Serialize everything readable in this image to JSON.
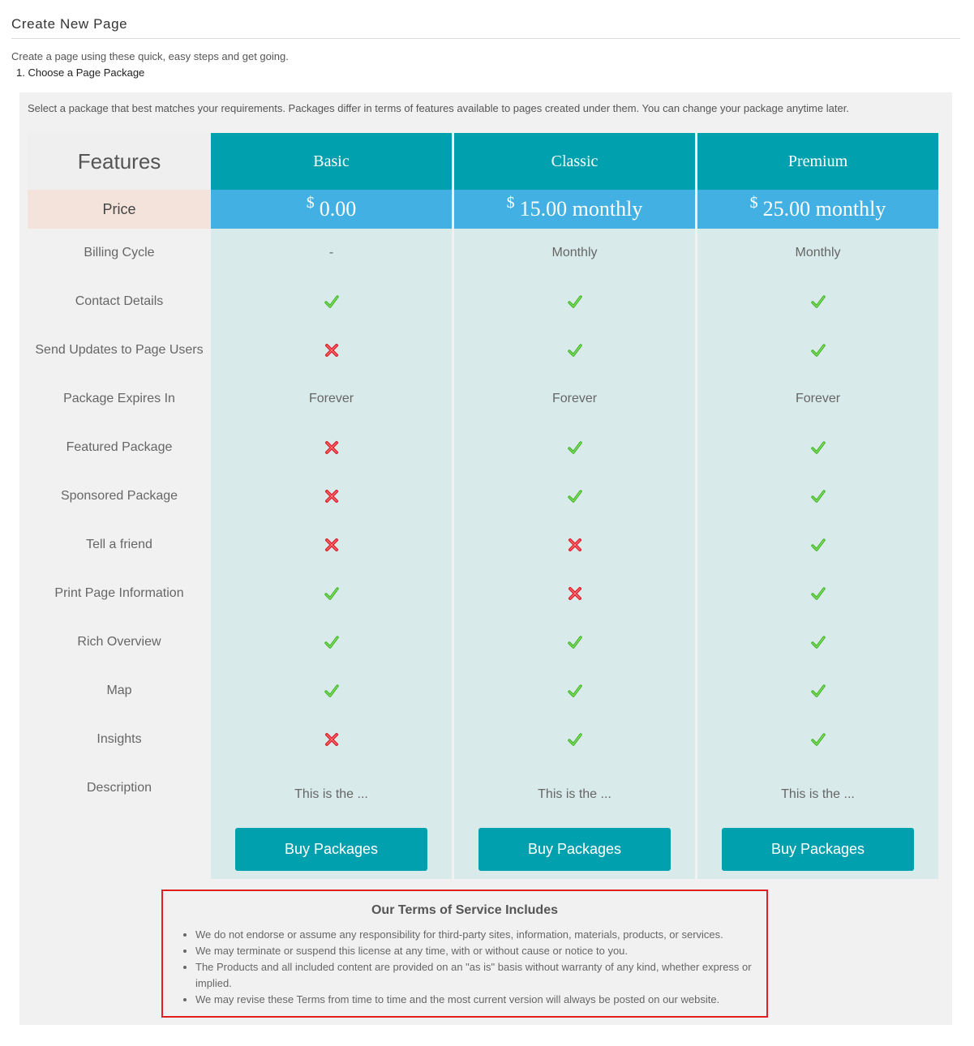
{
  "page": {
    "title": "Create New Page",
    "intro": "Create a page using these quick, easy steps and get going.",
    "step": "1. Choose a Page Package"
  },
  "panel": {
    "description": "Select a package that best matches your requirements. Packages differ in terms of features available to pages created under them. You can change your package anytime later."
  },
  "features": {
    "header": "Features",
    "price_label": "Price",
    "rows": [
      "Billing Cycle",
      "Contact Details",
      "Send Updates to Page Users",
      "Package Expires In",
      "Featured Package",
      "Sponsored Package",
      "Tell a friend",
      "Print Page Information",
      "Rich Overview",
      "Map",
      "Insights",
      "Description"
    ]
  },
  "plans": [
    {
      "name": "Basic",
      "currency": "$",
      "price": "0.00",
      "billing_cycle": "-",
      "contact_details": "check-icon",
      "send_updates": "cross-icon",
      "expires_in": "Forever",
      "featured": "cross-icon",
      "sponsored": "cross-icon",
      "tell_friend": "cross-icon",
      "print_info": "check-icon",
      "rich_overview": "check-icon",
      "map": "check-icon",
      "insights": "cross-icon",
      "description": "This is the ...",
      "button_label": "Buy Packages"
    },
    {
      "name": "Classic",
      "currency": "$",
      "price": "15.00 monthly",
      "billing_cycle": "Monthly",
      "contact_details": "check-icon",
      "send_updates": "check-icon",
      "expires_in": "Forever",
      "featured": "check-icon",
      "sponsored": "check-icon",
      "tell_friend": "cross-icon",
      "print_info": "cross-icon",
      "rich_overview": "check-icon",
      "map": "check-icon",
      "insights": "check-icon",
      "description": "This is the ...",
      "button_label": "Buy Packages"
    },
    {
      "name": "Premium",
      "currency": "$",
      "price": "25.00 monthly",
      "billing_cycle": "Monthly",
      "contact_details": "check-icon",
      "send_updates": "check-icon",
      "expires_in": "Forever",
      "featured": "check-icon",
      "sponsored": "check-icon",
      "tell_friend": "check-icon",
      "print_info": "check-icon",
      "rich_overview": "check-icon",
      "map": "check-icon",
      "insights": "check-icon",
      "description": "This is the ...",
      "button_label": "Buy Packages"
    }
  ],
  "terms": {
    "title": "Our Terms of Service Includes",
    "items": [
      "We do not endorse or assume any responsibility for third-party sites, information, materials, products, or services.",
      "We may terminate or suspend this license at any time, with or without cause or notice to you.",
      "The Products and all included content are provided on an \"as is\" basis without warranty of any kind, whether express or implied.",
      "We may revise these Terms from time to time and the most current version will always be posted on our website."
    ]
  },
  "colors": {
    "header_teal": "#00a0ae",
    "price_blue": "#42b0e2",
    "column_bg": "#d9eaea",
    "price_label_bg": "#f3e3da",
    "check_green": "#3cb521",
    "cross_red": "#e0202b",
    "terms_border": "#e02020"
  }
}
